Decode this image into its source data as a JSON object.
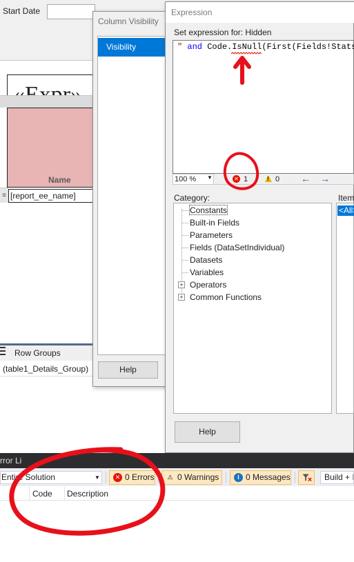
{
  "report": {
    "start_date_label": "Start Date",
    "expr_placeholder": "«Expr»",
    "header_label": "Name",
    "row_handle": "≡",
    "detail_value": "[report_ee_name]",
    "row_groups_label": "Row Groups",
    "group_item": "(table1_Details_Group)"
  },
  "column_visibility": {
    "title": "Column Visibility",
    "items": [
      "Visibility"
    ],
    "help_label": "Help"
  },
  "expression": {
    "title": "Expression",
    "set_label": "Set expression for: Hidden",
    "code": {
      "part1": "\" ",
      "part2": "and",
      "part3": " Code.IsNull(First(Fields!StatsU"
    },
    "status": {
      "zoom": "100 %",
      "errors": "1",
      "warnings": "0",
      "back_arrow": "←",
      "fwd_arrow": "→"
    },
    "category_label": "Category:",
    "items_label": "Item",
    "categories": [
      "Constants",
      "Built-in Fields",
      "Parameters",
      "Fields (DataSetIndividual)",
      "Datasets",
      "Variables",
      "Operators",
      "Common Functions"
    ],
    "items_selected": "<All>",
    "help_label": "Help"
  },
  "error_list": {
    "title": "rror Li",
    "scope": "Entire Solution",
    "errors_label": "0 Errors",
    "warnings_label": "0 Warnings",
    "messages_label": "0 Messages",
    "build_label": "Build + I",
    "col_code": "Code",
    "col_description": "Description"
  },
  "colors": {
    "accent": "#0078d7",
    "error": "#e51400",
    "annotation": "#e8101a"
  }
}
